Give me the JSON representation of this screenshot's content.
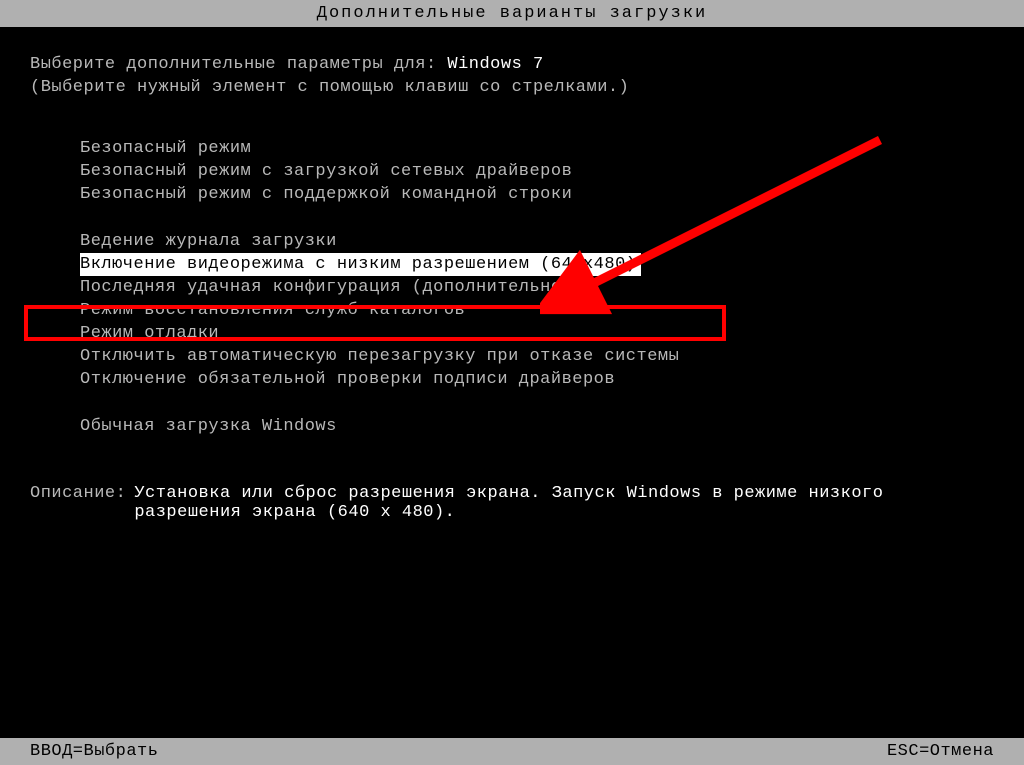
{
  "title": "Дополнительные варианты загрузки",
  "prompt_prefix": "Выберите дополнительные параметры для: ",
  "os_name": "Windows 7",
  "hint": "(Выберите нужный элемент с помощью клавиш со стрелками.)",
  "menu": {
    "group1": [
      "Безопасный режим",
      "Безопасный режим с загрузкой сетевых драйверов",
      "Безопасный режим с поддержкой командной строки"
    ],
    "group2": [
      "Ведение журнала загрузки",
      "Включение видеорежима с низким разрешением (640x480)",
      "Последняя удачная конфигурация (дополнительно)",
      "Режим восстановления служб каталогов",
      "Режим отладки",
      "Отключить автоматическую перезагрузку при отказе системы",
      "Отключение обязательной проверки подписи драйверов"
    ],
    "group3": [
      "Обычная загрузка Windows"
    ],
    "selected_index": {
      "group": 2,
      "item": 1
    }
  },
  "description": {
    "label": "Описание:",
    "text": "Установка или сброс разрешения экрана. Запуск Windows в режиме низкого разрешения экрана (640 x 480)."
  },
  "footer": {
    "left": "ВВОД=Выбрать",
    "right": "ESC=Отмена"
  },
  "annotation": {
    "arrow_color": "#ff0000"
  }
}
